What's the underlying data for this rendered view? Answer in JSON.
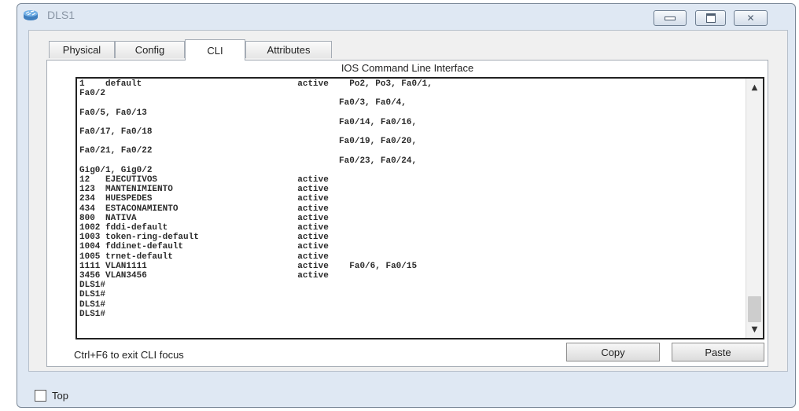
{
  "window": {
    "title": "DLS1",
    "icon": "router-switch-icon"
  },
  "tabs": [
    {
      "label": "Physical",
      "active": false
    },
    {
      "label": "Config",
      "active": false
    },
    {
      "label": "CLI",
      "active": true
    },
    {
      "label": "Attributes",
      "active": false
    }
  ],
  "cli": {
    "header": "IOS Command Line Interface",
    "output": "1    default                              active    Po2, Po3, Fa0/1,\nFa0/2\n                                                  Fa0/3, Fa0/4,\nFa0/5, Fa0/13\n                                                  Fa0/14, Fa0/16,\nFa0/17, Fa0/18\n                                                  Fa0/19, Fa0/20,\nFa0/21, Fa0/22\n                                                  Fa0/23, Fa0/24,\nGig0/1, Gig0/2\n12   EJECUTIVOS                           active\n123  MANTENIMIENTO                        active\n234  HUESPEDES                            active\n434  ESTACONAMIENTO                       active\n800  NATIVA                               active\n1002 fddi-default                         active\n1003 token-ring-default                   active\n1004 fddinet-default                      active\n1005 trnet-default                        active\n1111 VLAN1111                             active    Fa0/6, Fa0/15\n3456 VLAN3456                             active\nDLS1#\nDLS1#\nDLS1#\nDLS1#",
    "hint": "Ctrl+F6 to exit CLI focus",
    "copy_label": "Copy",
    "paste_label": "Paste"
  },
  "footer": {
    "top_label": "Top",
    "top_checked": false
  },
  "colors": {
    "window_frame": "#dfe8f3",
    "panel": "#f0f0f0",
    "console_border": "#222222"
  }
}
